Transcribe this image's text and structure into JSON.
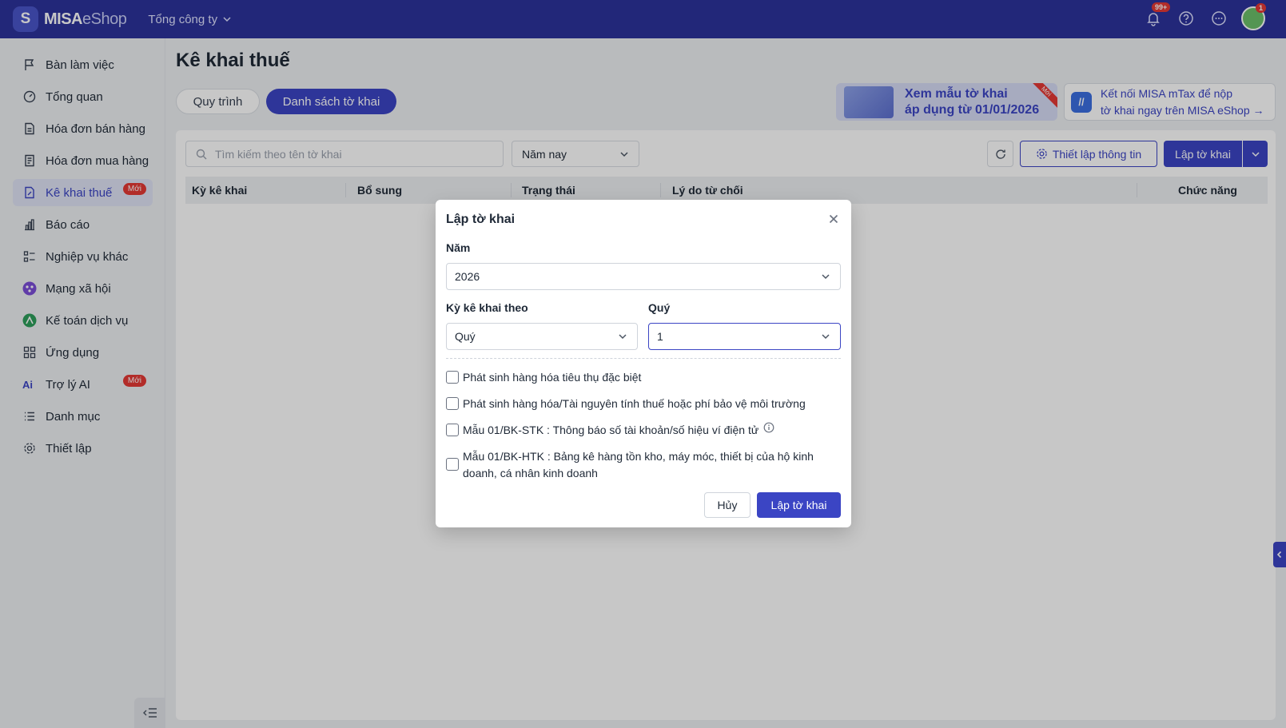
{
  "app": {
    "brand_bold": "MISA",
    "brand_light": "eShop",
    "company": "Tổng công ty",
    "notifications_badge": "99+",
    "avatar_badge": "1"
  },
  "sidebar": {
    "items": [
      {
        "label": "Bàn làm việc"
      },
      {
        "label": "Tổng quan"
      },
      {
        "label": "Hóa đơn bán hàng"
      },
      {
        "label": "Hóa đơn mua hàng"
      },
      {
        "label": "Kê khai thuế",
        "tag": "Mới"
      },
      {
        "label": "Báo cáo"
      },
      {
        "label": "Nghiệp vụ khác"
      },
      {
        "label": "Mạng xã hội"
      },
      {
        "label": "Kế toán dịch vụ"
      },
      {
        "label": "Ứng dụng"
      },
      {
        "label": "Trợ lý AI",
        "tag": "Mới"
      },
      {
        "label": "Danh mục"
      },
      {
        "label": "Thiết lập"
      }
    ]
  },
  "main": {
    "title": "Kê khai thuế",
    "tabs": [
      {
        "label": "Quy trình"
      },
      {
        "label": "Danh sách tờ khai"
      }
    ],
    "banner_new": {
      "line1": "Xem mẫu tờ khai",
      "line2": "áp dụng từ 01/01/2026",
      "ribbon": "Mới"
    },
    "banner_mtax": {
      "line1": "Kết nối MISA mTax để nộp",
      "line2": "tờ khai ngay trên MISA eShop →"
    },
    "toolbar": {
      "search_placeholder": "Tìm kiếm theo tên tờ khai",
      "period_select": "Năm nay",
      "setup_label": "Thiết lập thông tin",
      "create_label": "Lập tờ khai"
    },
    "table": {
      "columns": [
        "Kỳ kê khai",
        "Bổ sung",
        "Trạng thái",
        "Lý do từ chối",
        "Chức năng"
      ]
    }
  },
  "dialog": {
    "title": "Lập tờ khai",
    "year_label": "Năm",
    "year_value": "2026",
    "period_label": "Kỳ kê khai theo",
    "period_value": "Quý",
    "quarter_label": "Quý",
    "quarter_value": "1",
    "checkboxes": [
      {
        "label": "Phát sinh hàng hóa tiêu thụ đặc biệt"
      },
      {
        "label": "Phát sinh hàng hóa/Tài nguyên tính thuế hoặc phí bảo vệ môi trường"
      },
      {
        "label": "Mẫu 01/BK-STK : Thông báo số tài khoản/số hiệu ví điện tử"
      },
      {
        "label": "Mẫu 01/BK-HTK : Bảng kê hàng tồn kho, máy móc, thiết bị của hộ kinh doanh, cá nhân kinh doanh"
      }
    ],
    "cancel_label": "Hủy",
    "ok_label": "Lập tờ khai"
  },
  "colors": {
    "topbar": "#2c339b",
    "primary": "#3b45c4",
    "badge": "#e53935"
  }
}
